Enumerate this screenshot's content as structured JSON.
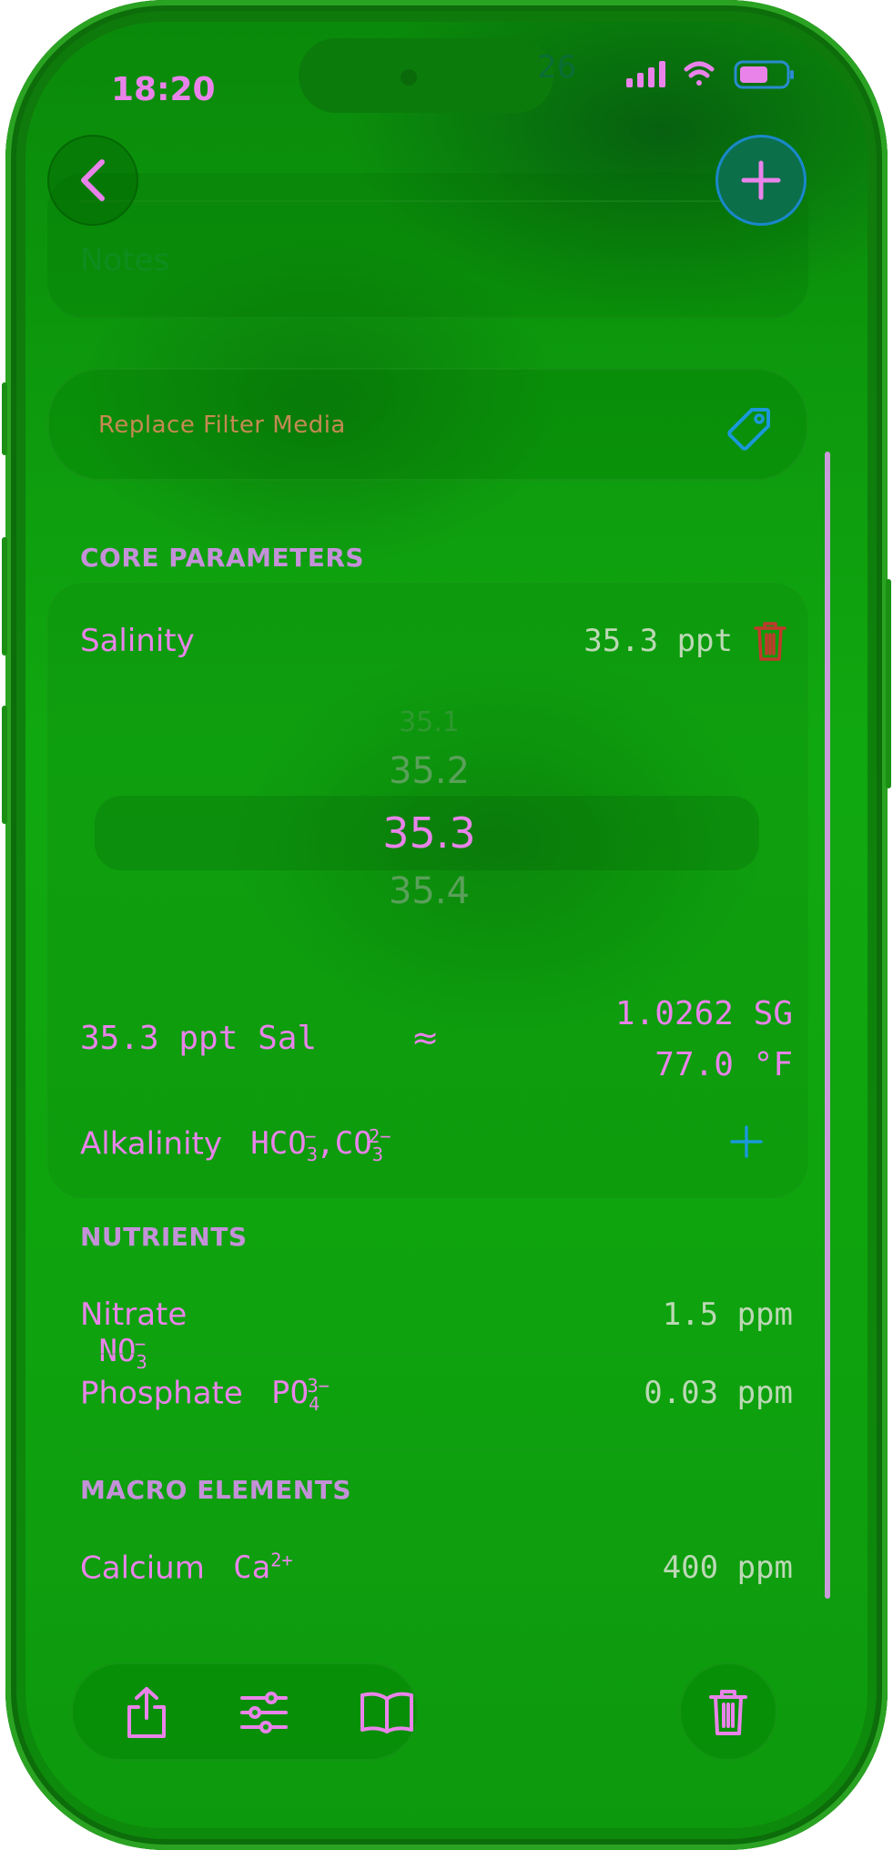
{
  "status": {
    "time": "18:20",
    "ghost": "26"
  },
  "notes": {
    "label": "Notes"
  },
  "filter": {
    "title": "Replace Filter Media"
  },
  "sections": {
    "core": "CORE PARAMETERS",
    "nutrients": "NUTRIENTS",
    "macro": "MACRO ELEMENTS"
  },
  "salinity": {
    "label": "Salinity",
    "value": "35.3 ppt",
    "picker": [
      "35.1",
      "35.2",
      "35.3",
      "35.4"
    ],
    "selected": "35.3"
  },
  "conversion": {
    "left": "35.3 ppt Sal",
    "approx": "≈",
    "sg": "1.0262 SG",
    "temp": "77.0 °F"
  },
  "alkalinity": {
    "label": "Alkalinity",
    "formula_a": "HCO",
    "formula_b": "CO"
  },
  "nitrate": {
    "label": "Nitrate",
    "formula": "NO",
    "value": "1.5 ppm"
  },
  "phosphate": {
    "label": "Phosphate",
    "formula": "PO",
    "value": "0.03 ppm"
  },
  "calcium": {
    "label": "Calcium",
    "formula": "Ca",
    "value": "400 ppm"
  },
  "colors": {
    "accent": "#e983ea",
    "value_text": "#bcd8b5",
    "delete_red": "#c0392b",
    "blue": "#1a88c9",
    "background": "#0fa00f"
  },
  "icons": [
    "back-chevron-icon",
    "plus-icon",
    "tag-icon",
    "trash-icon",
    "share-icon",
    "sliders-icon",
    "book-icon",
    "signal-icon",
    "wifi-icon",
    "battery-icon"
  ]
}
